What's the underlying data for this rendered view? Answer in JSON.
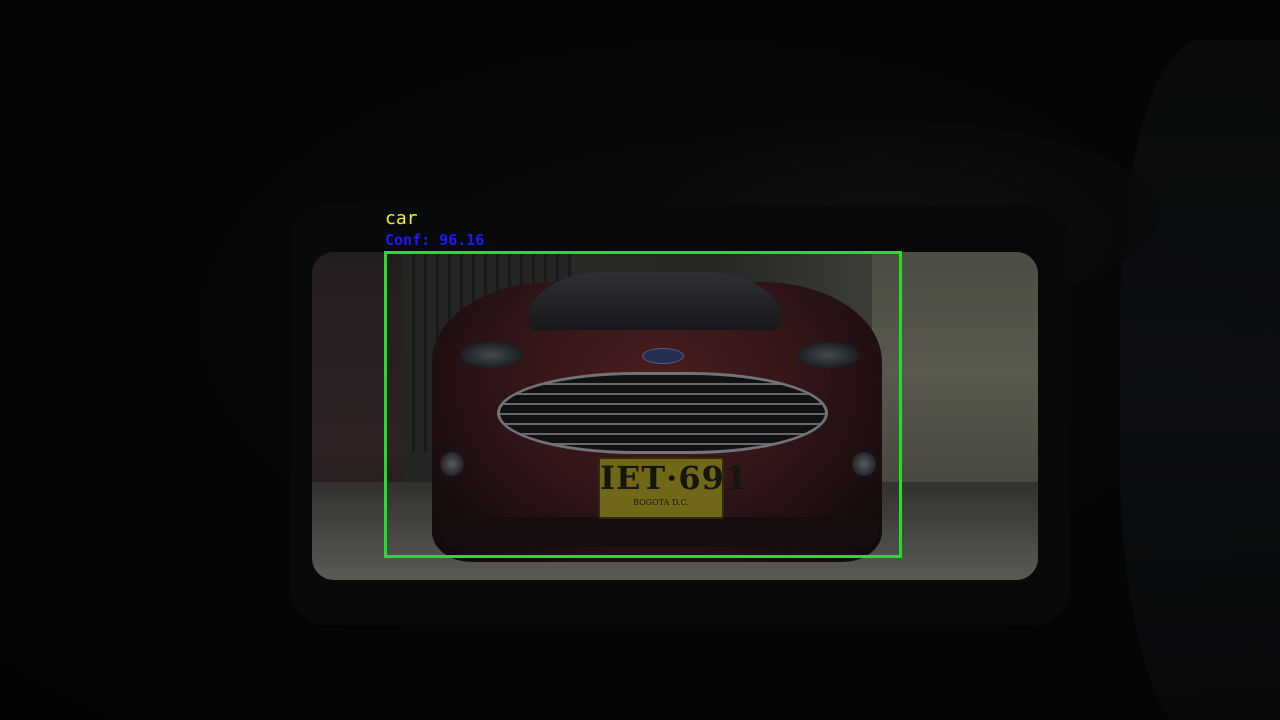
{
  "detection": {
    "label": "car",
    "confidence_text": "Conf: 96.16",
    "confidence": 96.16,
    "box_color": "#22e02a",
    "label_color": "#f2f22a",
    "confidence_color": "#1a1aff"
  },
  "plate": {
    "number": "IET·691",
    "city": "BOGOTA D.C."
  }
}
